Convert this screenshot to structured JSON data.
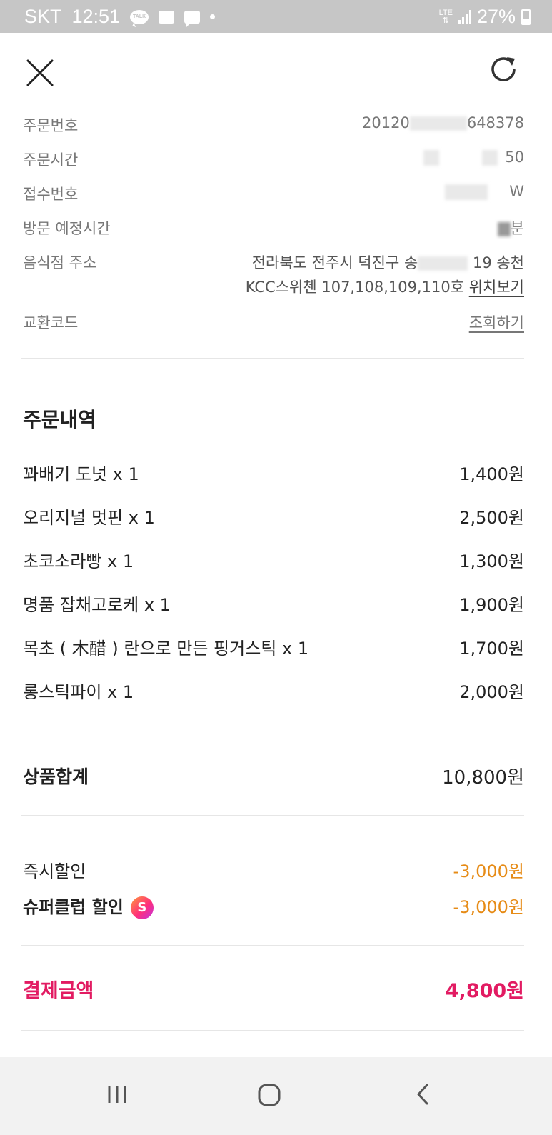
{
  "status_bar": {
    "carrier": "SKT",
    "time": "12:51",
    "talk_icon_text": "TALK",
    "network": "LTE",
    "battery": "27%"
  },
  "header": {
    "close_icon": "close-icon",
    "refresh_icon": "refresh-icon"
  },
  "info": {
    "order_number_label": "주문번호",
    "order_number_value_a": "20120",
    "order_number_value_b": "648378",
    "order_time_label": "주문시간",
    "order_time_value": "50",
    "receipt_number_label": "접수번호",
    "receipt_number_value": "W",
    "visit_time_label": "방문 예정시간",
    "visit_time_value": "분",
    "address_label": "음식점 주소",
    "address_line1_a": "전라북도 전주시 덕진구 송",
    "address_line1_b": "19 송천",
    "address_line2": "KCC스위첸 107,108,109,110호",
    "location_link": "위치보기",
    "exchange_code_label": "교환코드",
    "exchange_code_link": "조회하기"
  },
  "order": {
    "section_title": "주문내역",
    "items": [
      {
        "name": "꽈배기 도넛 x 1",
        "price": "1,400원"
      },
      {
        "name": "오리지널 멋핀 x 1",
        "price": "2,500원"
      },
      {
        "name": "초코소라빵 x 1",
        "price": "1,300원"
      },
      {
        "name": "명품 잡채고로케 x 1",
        "price": "1,900원"
      },
      {
        "name": "목초 ( 木醋 ) 란으로 만든 핑거스틱 x 1",
        "price": "1,700원"
      },
      {
        "name": "롱스틱파이 x 1",
        "price": "2,000원"
      }
    ]
  },
  "summary": {
    "subtotal_label": "상품합계",
    "subtotal_value": "10,800원",
    "instant_discount_label": "즉시할인",
    "instant_discount_value": "-3,000원",
    "superclub_discount_label": "슈퍼클럽 할인",
    "superclub_badge": "S",
    "superclub_discount_value": "-3,000원",
    "total_label": "결제금액",
    "total_value": "4,800원"
  },
  "colors": {
    "discount": "#e68b16",
    "total": "#e21b62",
    "status_bar": "#c6c6c6"
  }
}
